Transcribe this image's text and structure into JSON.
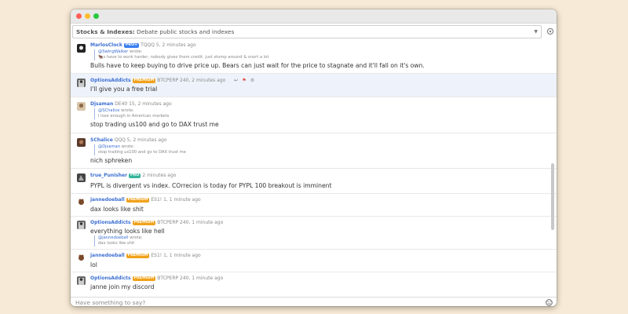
{
  "channel": {
    "name": "Stocks & Indexes:",
    "description": "Debate public stocks and indexes"
  },
  "icons": {
    "settings": "gear-icon",
    "dropdown": "chevron-down-icon",
    "emoji": "smiley-icon",
    "flag": "flag-icon",
    "reply": "reply-icon"
  },
  "colors": {
    "username": "#3c6fd1",
    "pro_badge": "#3a7ff0",
    "premium_badge": "#f0a21c",
    "pro_teal_badge": "#36b39a",
    "highlight_row": "#eef3fb"
  },
  "messages": [
    {
      "user": "MarlosClock",
      "badge": "PRO+",
      "symbol": "TQQQ 5",
      "time": ", 2 minutes ago",
      "quote_user": "@SwingWalker",
      "quote_suffix": " wrote:",
      "quote_text": "s have to work harder, nobody gives them credit.  just stomp around & snort a lot",
      "text": "Bulls have to keep buying to drive price up. Bears can just wait for the price to stagnate and it'll fall on it's own."
    },
    {
      "user": "OptionsAddicts",
      "badge": "PREMIUM",
      "symbol": "BTCPERP 240",
      "time": ", 2 minutes ago",
      "text": "I'll give you a free trial"
    },
    {
      "user": "Djsaman",
      "badge": "",
      "symbol": "DE40 15",
      "time": ", 2 minutes ago",
      "quote_user": "@SChalice",
      "quote_suffix": " wrote:",
      "quote_text": "I lose enough in American markets",
      "text": "stop trading us100 and go to DAX trust me"
    },
    {
      "user": "SChalice",
      "badge": "",
      "symbol": "QQQ 5",
      "time": ", 2 minutes ago",
      "quote_user": "@Djsaman",
      "quote_suffix": " wrote:",
      "quote_text": "stop trading us100 and go to DAX trust me",
      "text": "nich sphreken"
    },
    {
      "user": "true_Punisher",
      "badge": "PRO",
      "symbol": "",
      "time": "2 minutes ago",
      "text": "PYPL is divergent vs index. COrrecion is today for PYPL 100 breakout is imminent"
    },
    {
      "user": "jannedoeball",
      "badge": "PREMIUM",
      "symbol": "ES1! 1",
      "time": ", 1 minute ago",
      "text": "dax looks like shit"
    },
    {
      "user": "OptionsAddicts",
      "badge": "PREMIUM",
      "symbol": "BTCPERP 240",
      "time": ", 1 minute ago",
      "text": "everything looks like hell",
      "quote_user": "@jannedoeball",
      "quote_suffix": " wrote:",
      "quote_text": "dax looks like shit"
    },
    {
      "user": "jannedoeball",
      "badge": "PREMIUM",
      "symbol": "ES1! 1",
      "time": ", 1 minute ago",
      "text": "lol"
    },
    {
      "user": "OptionsAddicts",
      "badge": "PREMIUM",
      "symbol": "BTCPERP 240",
      "time": ", 1 minute ago",
      "text": "janne join my discord"
    }
  ],
  "composer": {
    "placeholder": "Have something to say?"
  }
}
